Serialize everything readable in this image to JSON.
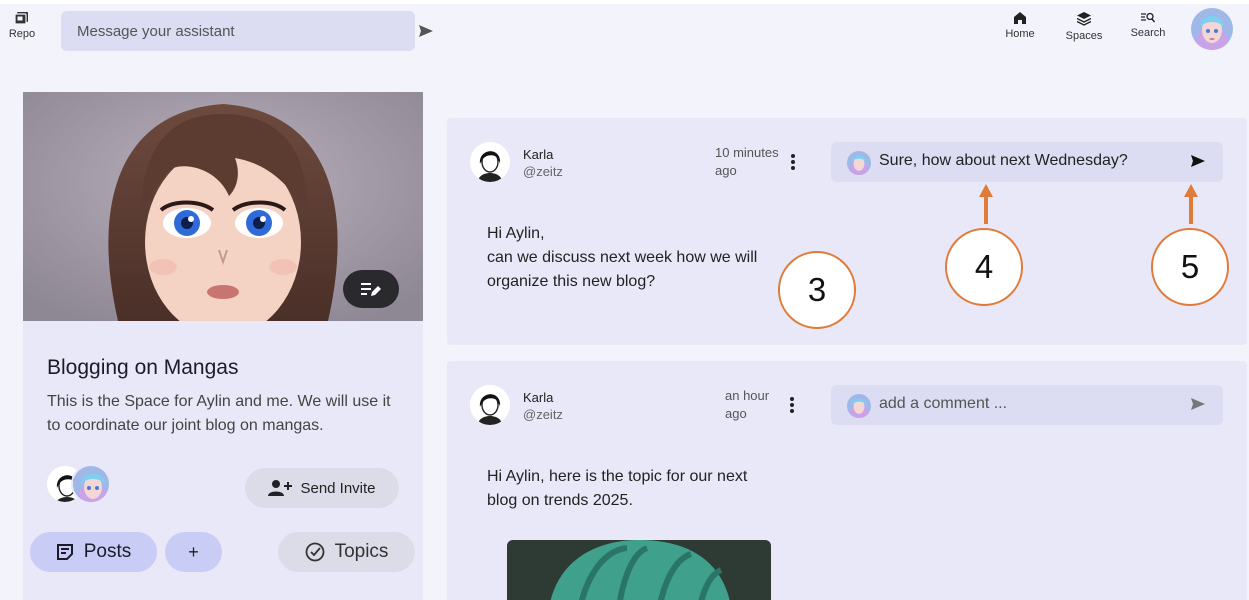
{
  "topbar": {
    "repo_label": "Repo",
    "message_placeholder": "Message your assistant",
    "nav": [
      {
        "label": "Home",
        "icon": "home-icon"
      },
      {
        "label": "Spaces",
        "icon": "layers-icon"
      },
      {
        "label": "Search",
        "icon": "search-icon"
      }
    ]
  },
  "space": {
    "title": "Blogging on Mangas",
    "description": "This is the Space for Aylin and me. We will use it to coordinate our joint blog on mangas.",
    "invite_label": "Send Invite",
    "posts_label": "Posts",
    "add_label": "+",
    "topics_label": "Topics"
  },
  "posts": [
    {
      "author": "Karla",
      "handle": "@zeitz",
      "time_line1": "10 minutes",
      "time_line2": "ago",
      "body_lines": [
        "Hi Aylin,",
        "can we discuss next week how we will",
        "organize this new blog?"
      ],
      "comment_value": "Sure, how about next Wednesday?"
    },
    {
      "author": "Karla",
      "handle": "@zeitz",
      "time_line1": "an hour",
      "time_line2": "ago",
      "body_lines": [
        "Hi Aylin, here is the topic for our next",
        "blog on trends 2025."
      ],
      "comment_placeholder": "add a comment ..."
    }
  ],
  "annotations": [
    "3",
    "4",
    "5"
  ],
  "colors": {
    "accent": "#c9ccf5",
    "annotation": "#e07b39",
    "card": "#e8e8f8"
  }
}
